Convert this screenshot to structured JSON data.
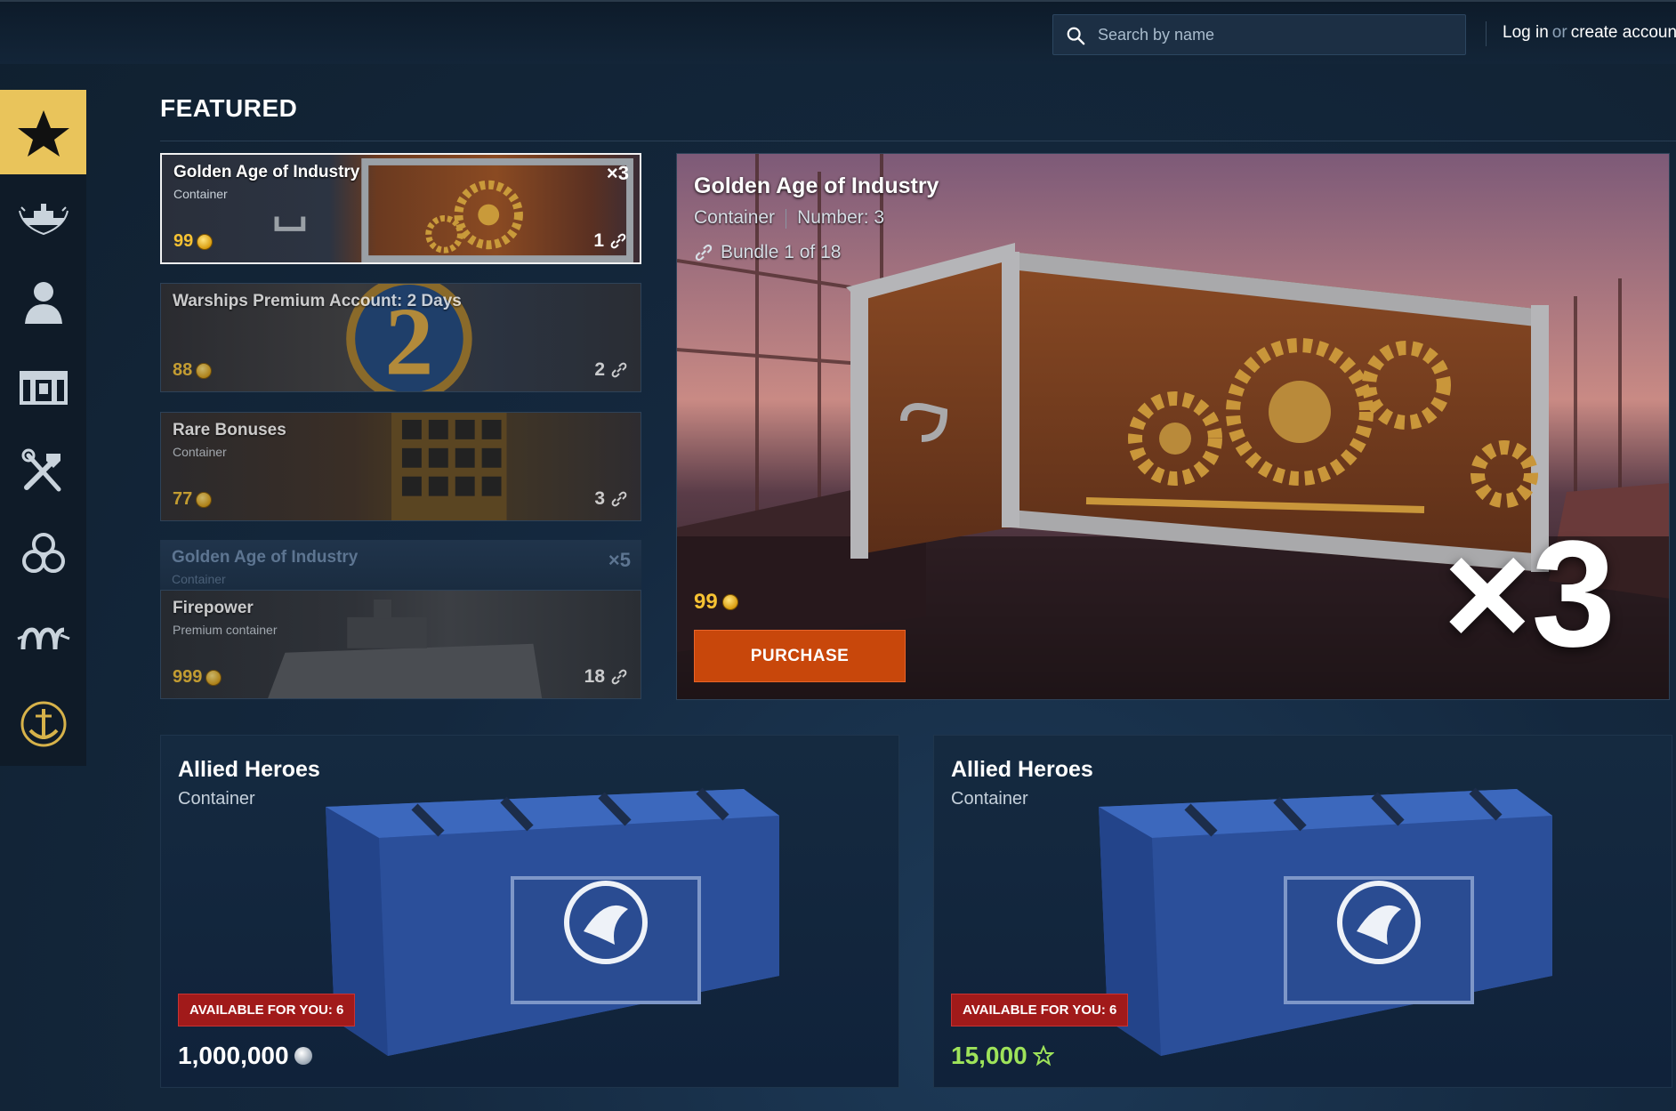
{
  "header": {
    "search_placeholder": "Search by name",
    "login_label": "Log in",
    "or_label": "or",
    "create_label": "create account"
  },
  "sidebar": {
    "items": [
      {
        "icon": "star-icon",
        "active": true
      },
      {
        "icon": "warship-icon"
      },
      {
        "icon": "commander-icon"
      },
      {
        "icon": "containers-icon"
      },
      {
        "icon": "tools-icon"
      },
      {
        "icon": "camouflage-icon"
      },
      {
        "icon": "kraken-icon"
      },
      {
        "icon": "anchor-emblem-icon"
      }
    ]
  },
  "featured": {
    "title": "FEATURED",
    "cards": [
      {
        "name": "Golden Age of Industry",
        "type": "Container",
        "price": "99",
        "count": "1",
        "multiplier": "×3"
      },
      {
        "name": "Warships Premium Account: 2 Days",
        "price": "88",
        "count": "2"
      },
      {
        "name": "Rare Bonuses",
        "type": "Container",
        "price": "77",
        "count": "3"
      },
      {
        "name": "Golden Age of Industry",
        "type": "Container",
        "multiplier": "×5"
      },
      {
        "name": "Firepower",
        "type": "Premium container",
        "price": "999",
        "count": "18"
      }
    ]
  },
  "hero": {
    "title": "Golden Age of Industry",
    "type": "Container",
    "number": "Number: 3",
    "bundle": "Bundle 1 of 18",
    "price": "99",
    "purchase_label": "PURCHASE",
    "multiplier": "×3"
  },
  "offers": [
    {
      "name": "Allied Heroes",
      "type": "Container",
      "availability": "AVAILABLE FOR YOU: 6",
      "price": "1,000,000",
      "currency": "credits",
      "price_color": "#ffffff"
    },
    {
      "name": "Allied Heroes",
      "type": "Container",
      "availability": "AVAILABLE FOR YOU: 6",
      "price": "15,000",
      "currency": "free-xp",
      "price_color": "#9ee35a"
    }
  ]
}
